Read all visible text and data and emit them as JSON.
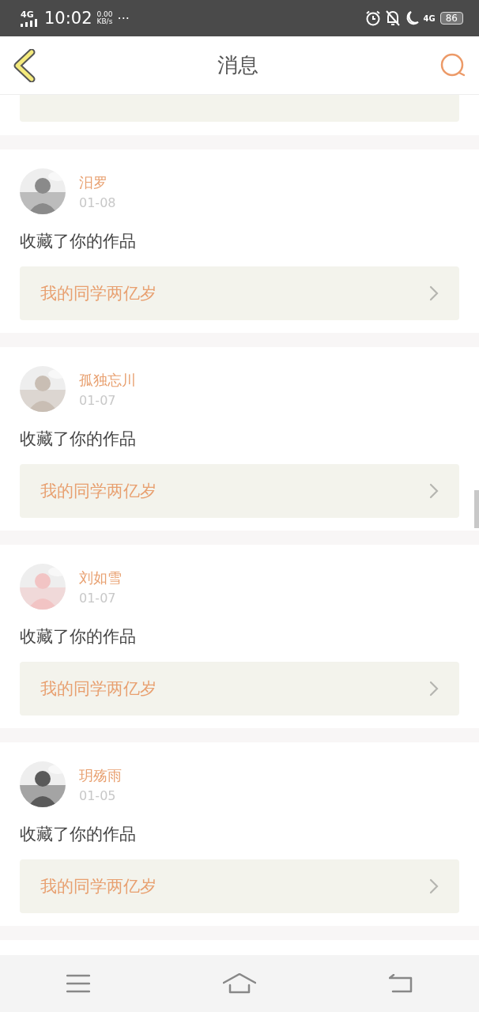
{
  "status_bar": {
    "network": "4G",
    "time": "10:02",
    "speed": "0.00",
    "speed_unit": "KB/s",
    "more": "···",
    "mobile_data": "4G",
    "battery": "86"
  },
  "header": {
    "title": "消息"
  },
  "messages": [
    {
      "name": "汨罗",
      "date": "01-08",
      "action": "收藏了你的作品",
      "work": "我的同学两亿岁"
    },
    {
      "name": "孤独忘川",
      "date": "01-07",
      "action": "收藏了你的作品",
      "work": "我的同学两亿岁"
    },
    {
      "name": "刘如雪",
      "date": "01-07",
      "action": "收藏了你的作品",
      "work": "我的同学两亿岁"
    },
    {
      "name": "玥殇雨",
      "date": "01-05",
      "action": "收藏了你的作品",
      "work": "我的同学两亿岁"
    }
  ]
}
